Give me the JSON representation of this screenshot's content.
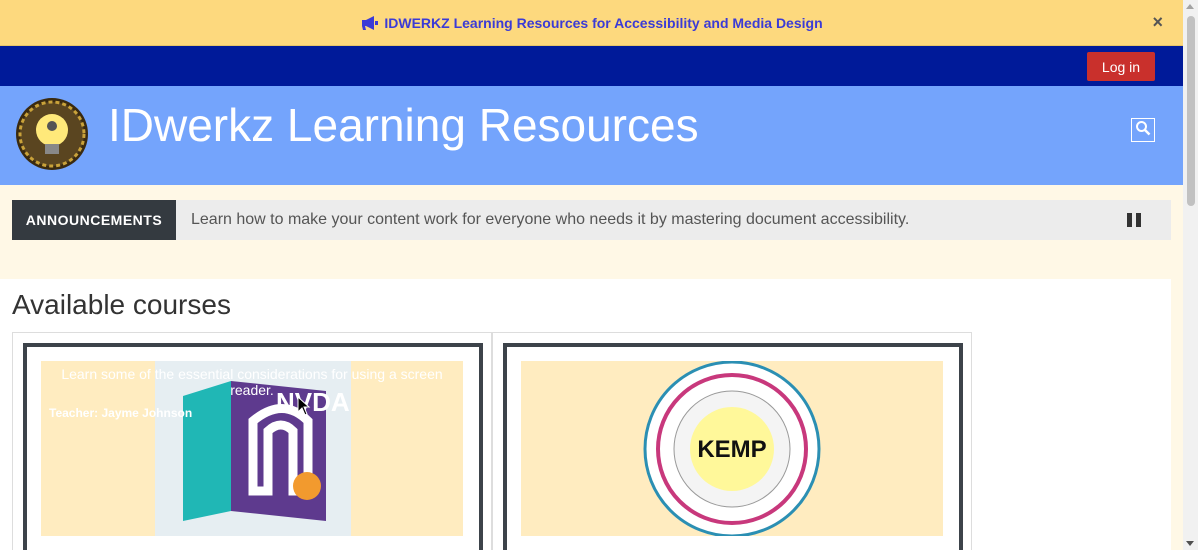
{
  "notice": {
    "text": "IDWERKZ Learning Resources for Accessibility and Media Design",
    "close": "×",
    "icon": "megaphone-icon"
  },
  "navbar": {
    "login_label": "Log in"
  },
  "header": {
    "title": "IDwerkz Learning Resources",
    "search_icon": "search-icon"
  },
  "announcements": {
    "label": "ANNOUNCEMENTS",
    "text": "Learn how to make your content work for everyone who needs it by mastering document accessibility."
  },
  "main": {
    "title": "Available courses",
    "courses": [
      {
        "summary": "Learn some of the essential considerations for using a screen reader.",
        "teacher": "Teacher: Jayme Johnson",
        "image_label": "NVDA"
      },
      {
        "image_label": "KEMP"
      }
    ]
  },
  "colors": {
    "notice_bg": "#fdd97e",
    "navbar_bg": "#001a99",
    "header_bg": "#74a4fc",
    "login_bg": "#c9302c",
    "page_bg": "#fff8e6"
  }
}
